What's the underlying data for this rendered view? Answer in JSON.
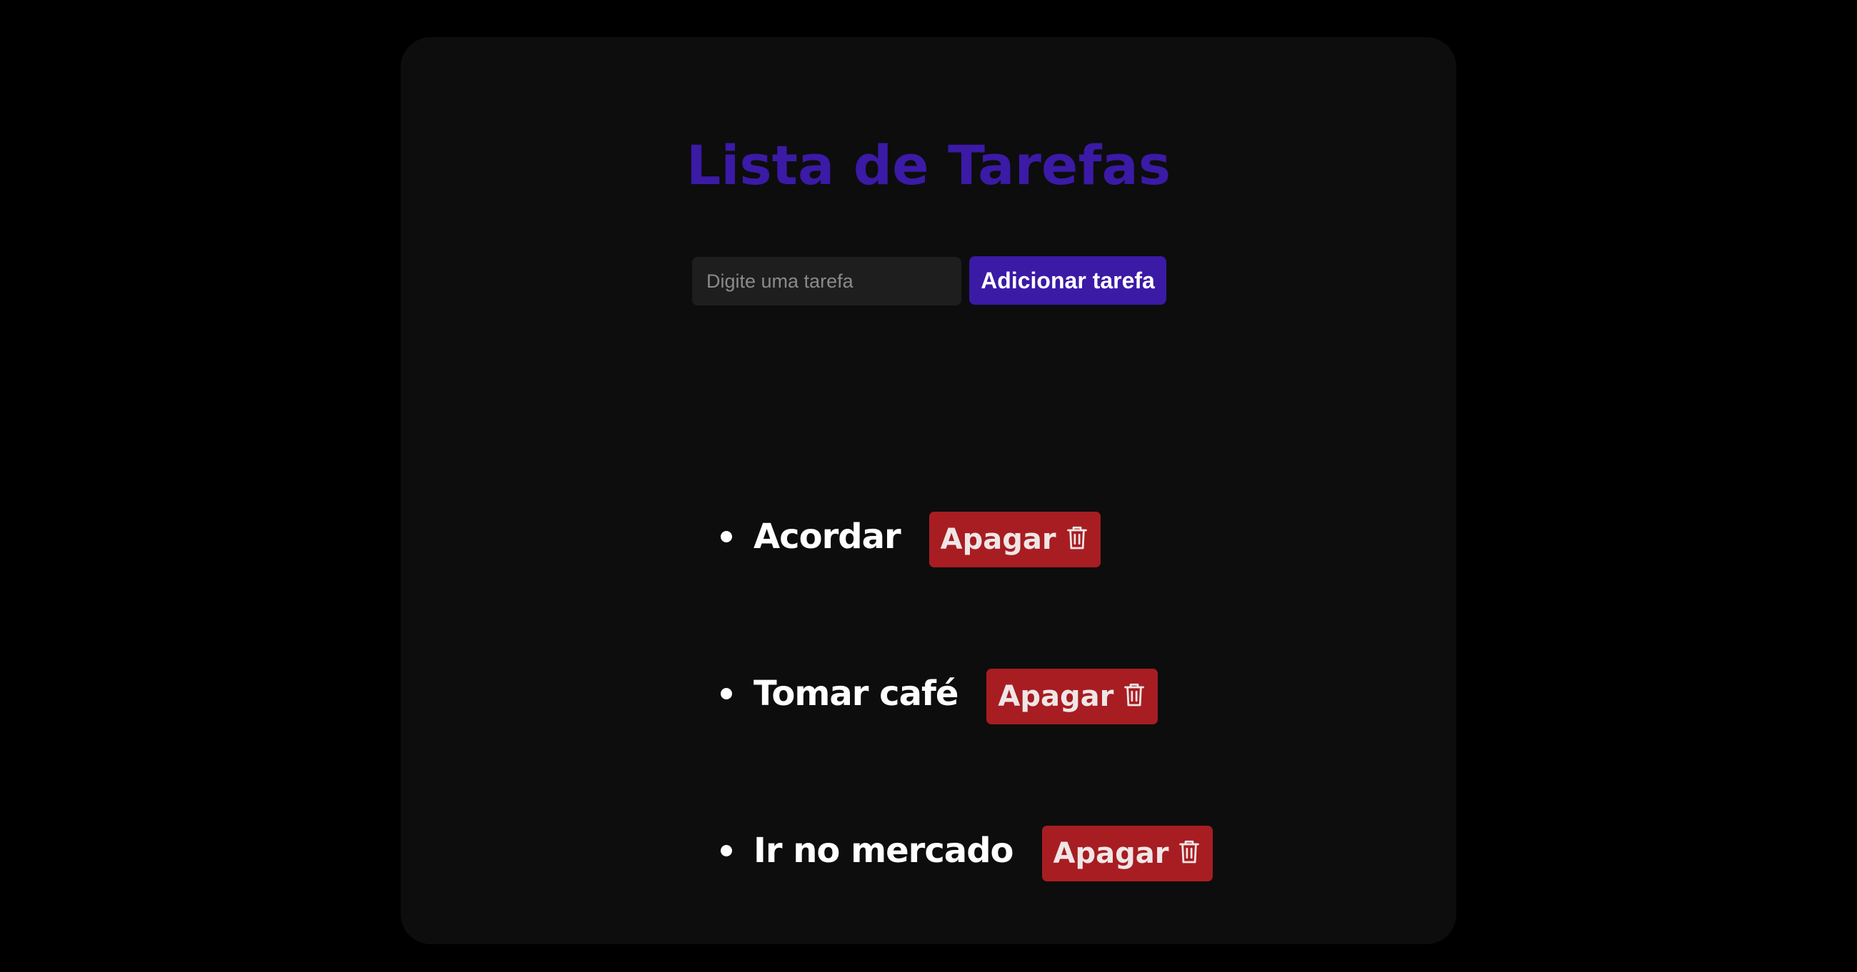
{
  "header": {
    "title": "Lista de Tarefas"
  },
  "form": {
    "input_placeholder": "Digite uma tarefa",
    "input_value": "",
    "add_button_label": "Adicionar tarefa"
  },
  "tasks": [
    {
      "label": "Acordar",
      "delete_label": "Apagar",
      "delete_icon": "trash-icon"
    },
    {
      "label": "Tomar café",
      "delete_label": "Apagar",
      "delete_icon": "trash-icon"
    },
    {
      "label": "Ir no mercado",
      "delete_label": "Apagar",
      "delete_icon": "trash-icon"
    }
  ],
  "colors": {
    "background": "#000000",
    "card": "#0d0d0d",
    "accent": "#3b1aa6",
    "danger": "#a71d22",
    "input_bg": "#1e1e1e",
    "text": "#ffffff"
  }
}
